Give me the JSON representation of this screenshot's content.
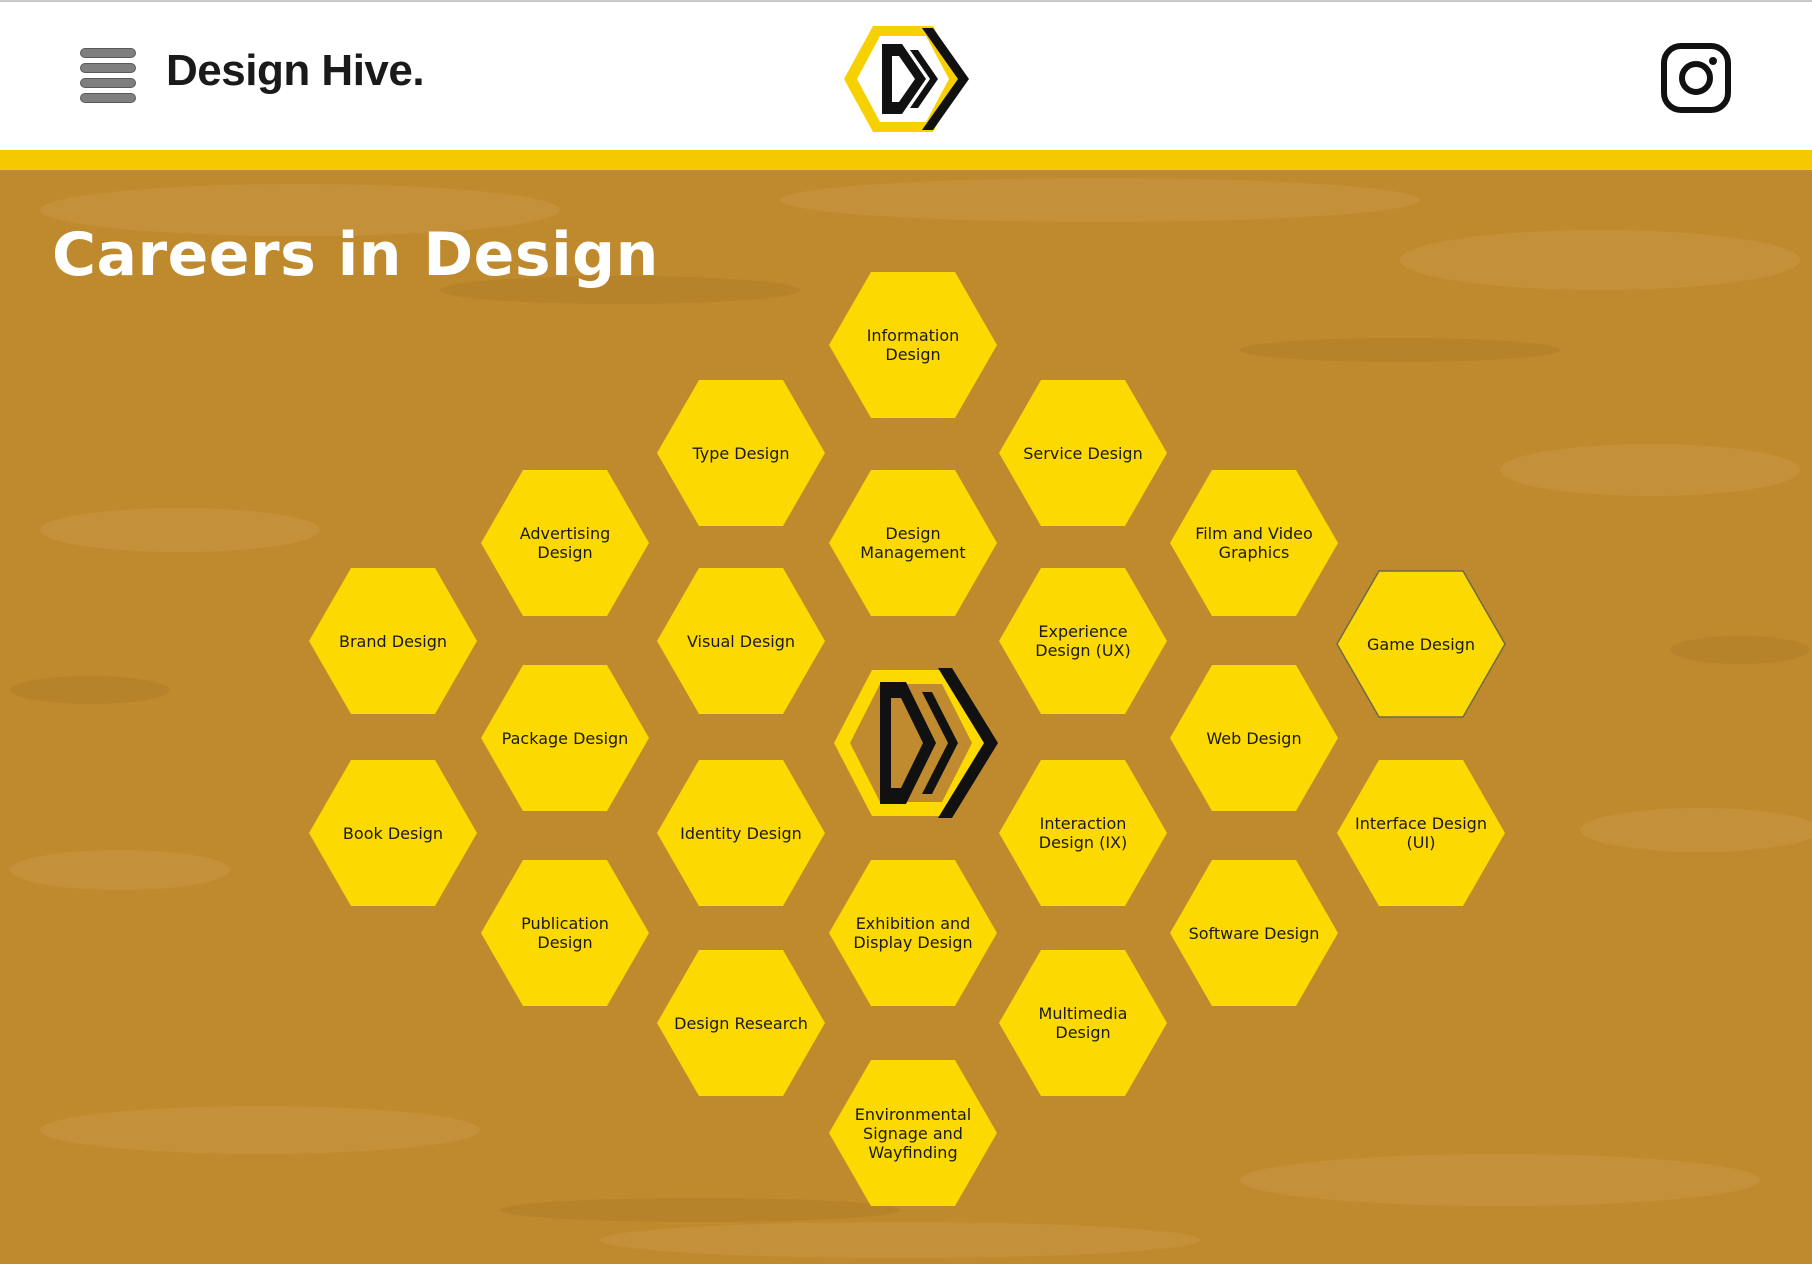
{
  "header": {
    "brand": "Design Hive.",
    "menu_icon": "hamburger-menu-icon",
    "logo_icon": "design-hive-logo-icon",
    "social_icon": "instagram-icon"
  },
  "page": {
    "title": "Careers in Design"
  },
  "colors": {
    "background": "#bf8a2e",
    "accent_yellow": "#fcd900",
    "header_band": "#f6c800",
    "text_dark": "#1a1a1a"
  },
  "hexagons": [
    {
      "label": "Information Design"
    },
    {
      "label": "Type Design"
    },
    {
      "label": "Service Design"
    },
    {
      "label": "Design Management"
    },
    {
      "label": "Advertising Design"
    },
    {
      "label": "Film and Video Graphics"
    },
    {
      "label": "Brand Design"
    },
    {
      "label": "Visual Design"
    },
    {
      "label": "Experience Design (UX)"
    },
    {
      "label": "Game Design"
    },
    {
      "label": "Package Design"
    },
    {
      "label": "Web Design"
    },
    {
      "label": "Book Design"
    },
    {
      "label": "Identity Design"
    },
    {
      "label": "Interaction Design (IX)"
    },
    {
      "label": "Interface Design (UI)"
    },
    {
      "label": "Publication Design"
    },
    {
      "label": "Exhibition and Display Design"
    },
    {
      "label": "Software Design"
    },
    {
      "label": "Design Research"
    },
    {
      "label": "Multimedia Design"
    },
    {
      "label": "Environmental Signage and Wayfinding"
    }
  ]
}
